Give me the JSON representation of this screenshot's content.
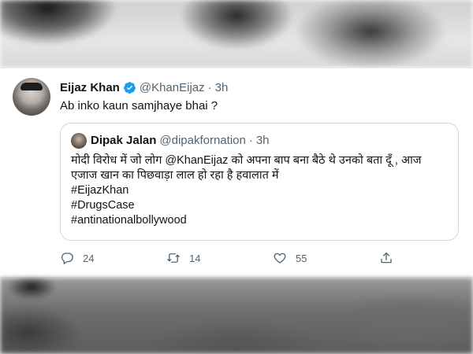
{
  "tweet": {
    "author_name": "Eijaz Khan",
    "verified": true,
    "handle": "@KhanEijaz",
    "separator": "·",
    "time": "3h",
    "text": "Ab inko kaun samjhaye bhai ?"
  },
  "quoted": {
    "author_name": "Dipak Jalan",
    "handle": "@dipakfornation",
    "separator": "·",
    "time": "3h",
    "body_line1": "मोदी विरोध में जो लोग @KhanEijaz को अपना बाप बना बैठे थे उनको बता दूँ , आज",
    "body_line2": "एजाज खान का पिछवाड़ा लाल हो रहा है हवालात में",
    "hashtags": [
      "#EijazKhan",
      "#DrugsCase",
      "#antinationalbollywood"
    ]
  },
  "actions": {
    "reply_count": "24",
    "retweet_count": "14",
    "like_count": "55"
  },
  "icons": {
    "verified": "verified-badge-icon",
    "reply": "reply-icon",
    "retweet": "retweet-icon",
    "like": "heart-icon",
    "share": "share-icon"
  },
  "colors": {
    "verified": "#1d9bf0",
    "secondary_text": "#536471",
    "border": "#cfd9de"
  }
}
